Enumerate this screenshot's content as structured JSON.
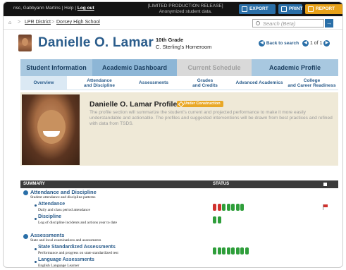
{
  "topbar": {
    "user_text": "nsc, Gabbyann Martins",
    "help": "Help",
    "logout": "Log out",
    "notice_line1": "[LIMITED PRODUCTION RELEASE]",
    "notice_line2": "Anonymized student data.",
    "export_all": "EXPORT ALL",
    "print": "PRINT",
    "report": "REPORT"
  },
  "breadcrumb": {
    "district": "LPR District",
    "school": "Dorsey High School",
    "separator": ">"
  },
  "search": {
    "placeholder": "Search (Beta)"
  },
  "student": {
    "name": "Danielle O. Lamar",
    "grade": "10th Grade",
    "homeroom": "C. Sterling's Homeroom",
    "back": "Back to search",
    "pager": "1 of 1"
  },
  "tabs": [
    {
      "label": "Student Information"
    },
    {
      "label": "Academic Dashboard"
    },
    {
      "label": "Current Schedule"
    },
    {
      "label": "Academic Profile"
    }
  ],
  "subtabs": [
    {
      "label": "Overview"
    },
    {
      "line1": "Attendance",
      "line2": "and Discipline"
    },
    {
      "label": "Assessments"
    },
    {
      "line1": "Grades",
      "line2": "and Credits"
    },
    {
      "label": "Advanced Academics"
    },
    {
      "line1": "College",
      "line2": "and Career Readiness"
    }
  ],
  "profile": {
    "title": "Danielle O. Lamar Profile",
    "badge": "Under Construction",
    "description": "The profile section will summarize the student's current and projected performance to make it more easily understandable and actionable. The profiles and suggested interventions will be drawn from best practices and refined with data from TSDS."
  },
  "summary": {
    "col_summary": "SUMMARY",
    "col_status": "STATUS",
    "sections": [
      {
        "title": "Attendance and Discipline",
        "subtitle": "Student attendance and discipline patterns",
        "items": [
          {
            "title": "Attendance",
            "subtitle": "Daily and class period attendance",
            "status": [
              "red",
              "red",
              "green",
              "green",
              "green",
              "green",
              "green"
            ],
            "flagged": true
          },
          {
            "title": "Discipline",
            "subtitle": "Log of discipline incidents and actions year to date",
            "status": [
              "green",
              "green"
            ],
            "flagged": false
          }
        ]
      },
      {
        "title": "Assessments",
        "subtitle": "State and local examinations and assessments",
        "items": [
          {
            "title": "State Standardized Assessments",
            "subtitle": "Performance and progress on state standardized test",
            "status": [
              "green",
              "green",
              "green",
              "green",
              "green",
              "green",
              "green",
              "green"
            ],
            "flagged": false
          },
          {
            "title": "Language Assessments",
            "subtitle": "English Language Learner",
            "status": [],
            "flagged": false
          }
        ]
      }
    ]
  },
  "colors": {
    "status_red": "#d0312d",
    "status_green": "#2e9e3a",
    "brand_blue": "#2b5d8c",
    "accent_orange": "#e9a826"
  }
}
